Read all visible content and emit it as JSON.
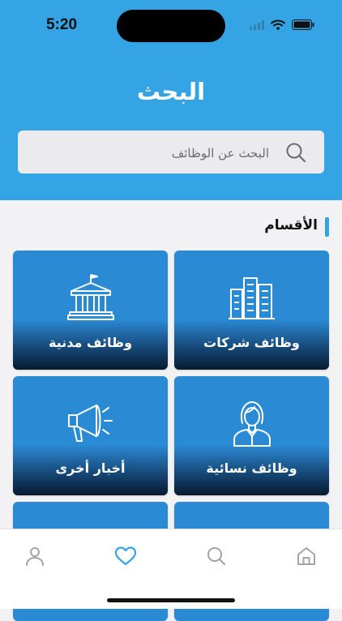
{
  "status_bar": {
    "time": "5:20"
  },
  "header": {
    "title": "البحث",
    "search": {
      "placeholder": "البحث عن الوظائف",
      "value": ""
    }
  },
  "section": {
    "title": "الأقسام"
  },
  "categories": [
    {
      "label": "وظائف شركات",
      "icon": "buildings-icon"
    },
    {
      "label": "وظائف مدنية",
      "icon": "government-building-icon"
    },
    {
      "label": "وظائف نسائية",
      "icon": "woman-icon"
    },
    {
      "label": "أخبار أخرى",
      "icon": "megaphone-icon"
    }
  ],
  "bottom_nav": {
    "items": [
      {
        "icon": "home-icon",
        "active": false
      },
      {
        "icon": "search-icon",
        "active": false
      },
      {
        "icon": "heart-icon",
        "active": true
      },
      {
        "icon": "user-icon",
        "active": false
      }
    ],
    "active_color": "#35a4e4",
    "inactive_color": "#a0a4ab"
  },
  "colors": {
    "accent": "#35a4e4",
    "tile": "#2a8ad4"
  }
}
